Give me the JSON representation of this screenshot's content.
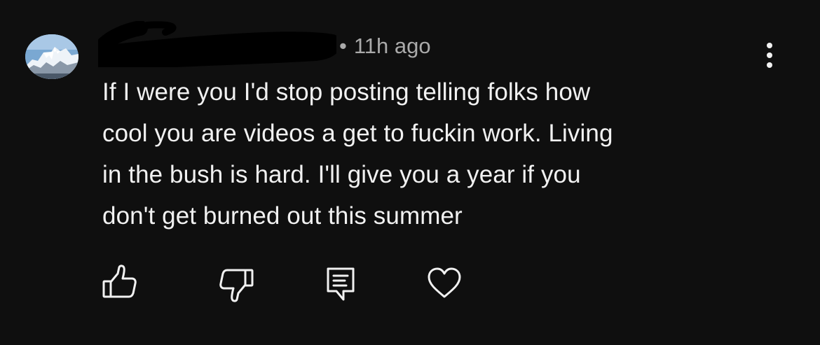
{
  "comment": {
    "author_icon": "avatar-snowy-mountain",
    "timestamp_dot": "•",
    "timestamp": "11h ago",
    "text_lines": [
      "If I were you I'd stop posting telling folks how",
      "cool you are videos a get to fuckin work. Living",
      "in the bush is hard. I'll give you a year if you",
      "don't get burned out this summer"
    ]
  },
  "actions": [
    {
      "icon": "thumbs-up-icon"
    },
    {
      "icon": "thumbs-down-icon"
    },
    {
      "icon": "reply-comment-icon"
    },
    {
      "icon": "heart-icon"
    }
  ],
  "menu": {
    "icon": "more-vertical-icon"
  },
  "colors": {
    "background": "#0f0f0f",
    "text": "#f1f1f1",
    "meta_text": "#aaaaaa"
  }
}
